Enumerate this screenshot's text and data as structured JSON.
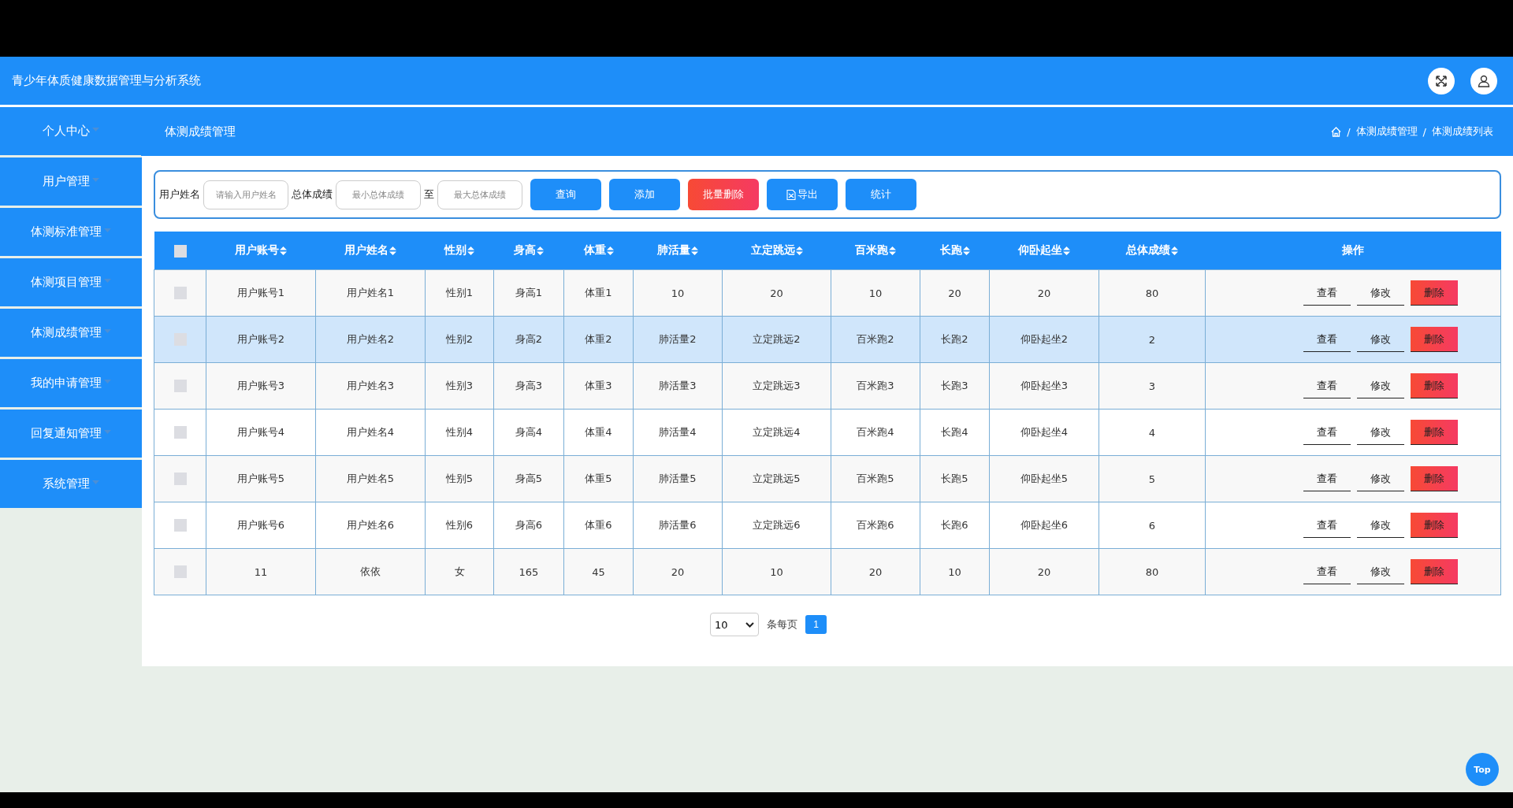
{
  "header": {
    "title": "青少年体质健康数据管理与分析系统"
  },
  "sidebar": {
    "items": [
      {
        "label": "个人中心",
        "selected": false
      },
      {
        "label": "用户管理",
        "selected": false
      },
      {
        "label": "体测标准管理",
        "selected": false
      },
      {
        "label": "体测项目管理",
        "selected": false
      },
      {
        "label": "体测成绩管理",
        "selected": false
      },
      {
        "label": "我的申请管理",
        "selected": false
      },
      {
        "label": "回复通知管理",
        "selected": false
      },
      {
        "label": "系统管理",
        "selected": false
      }
    ]
  },
  "page_title": "体测成绩管理",
  "breadcrumb": [
    {
      "kind": "separator",
      "text": "/"
    },
    {
      "kind": "link",
      "text": "体测成绩管理"
    },
    {
      "kind": "separator",
      "text": "/"
    },
    {
      "kind": "link",
      "text": "体测成绩列表"
    }
  ],
  "search": {
    "name_label": "用户姓名",
    "name_placeholder": "请输入用户姓名",
    "score_label": "总体成绩",
    "min_placeholder": "最小总体成绩",
    "to_label": "至",
    "max_placeholder": "最大总体成绩",
    "buttons": [
      {
        "label": "查询",
        "kind": "primary"
      },
      {
        "label": "添加",
        "kind": "primary"
      },
      {
        "label": "批量删除",
        "kind": "danger"
      },
      {
        "label": "导出",
        "kind": "export"
      },
      {
        "label": "统计",
        "kind": "primary"
      }
    ]
  },
  "table": {
    "select_all_checked": false,
    "columns": [
      "用户账号",
      "用户姓名",
      "性别",
      "身高",
      "体重",
      "肺活量",
      "立定跳远",
      "百米跑",
      "长跑",
      "仰卧起坐",
      "总体成绩"
    ],
    "action_column": "操作",
    "rows": [
      {
        "checked": false,
        "highlighted": false,
        "actions": [
          "查看",
          "修改",
          "删除"
        ],
        "cells": [
          "用户账号1",
          "用户姓名1",
          "性别1",
          "身高1",
          "体重1",
          "10",
          "20",
          "10",
          "20",
          "20",
          "80"
        ]
      },
      {
        "checked": false,
        "highlighted": true,
        "actions": [
          "查看",
          "修改",
          "删除"
        ],
        "cells": [
          "用户账号2",
          "用户姓名2",
          "性别2",
          "身高2",
          "体重2",
          "肺活量2",
          "立定跳远2",
          "百米跑2",
          "长跑2",
          "仰卧起坐2",
          "2"
        ]
      },
      {
        "checked": false,
        "highlighted": false,
        "actions": [
          "查看",
          "修改",
          "删除"
        ],
        "cells": [
          "用户账号3",
          "用户姓名3",
          "性别3",
          "身高3",
          "体重3",
          "肺活量3",
          "立定跳远3",
          "百米跑3",
          "长跑3",
          "仰卧起坐3",
          "3"
        ]
      },
      {
        "checked": false,
        "highlighted": false,
        "actions": [
          "查看",
          "修改",
          "删除"
        ],
        "cells": [
          "用户账号4",
          "用户姓名4",
          "性别4",
          "身高4",
          "体重4",
          "肺活量4",
          "立定跳远4",
          "百米跑4",
          "长跑4",
          "仰卧起坐4",
          "4"
        ]
      },
      {
        "checked": false,
        "highlighted": false,
        "actions": [
          "查看",
          "修改",
          "删除"
        ],
        "cells": [
          "用户账号5",
          "用户姓名5",
          "性别5",
          "身高5",
          "体重5",
          "肺活量5",
          "立定跳远5",
          "百米跑5",
          "长跑5",
          "仰卧起坐5",
          "5"
        ]
      },
      {
        "checked": false,
        "highlighted": false,
        "actions": [
          "查看",
          "修改",
          "删除"
        ],
        "cells": [
          "用户账号6",
          "用户姓名6",
          "性别6",
          "身高6",
          "体重6",
          "肺活量6",
          "立定跳远6",
          "百米跑6",
          "长跑6",
          "仰卧起坐6",
          "6"
        ]
      },
      {
        "checked": false,
        "highlighted": false,
        "actions": [
          "查看",
          "修改",
          "删除"
        ],
        "cells": [
          "11",
          "依依",
          "女",
          "165",
          "45",
          "20",
          "10",
          "20",
          "10",
          "20",
          "80"
        ]
      }
    ]
  },
  "pagination": {
    "page_size": "10",
    "page_size_label": "条每页",
    "pages": [
      {
        "label": "1",
        "selected": true
      }
    ]
  },
  "back_to_top": "Top"
}
